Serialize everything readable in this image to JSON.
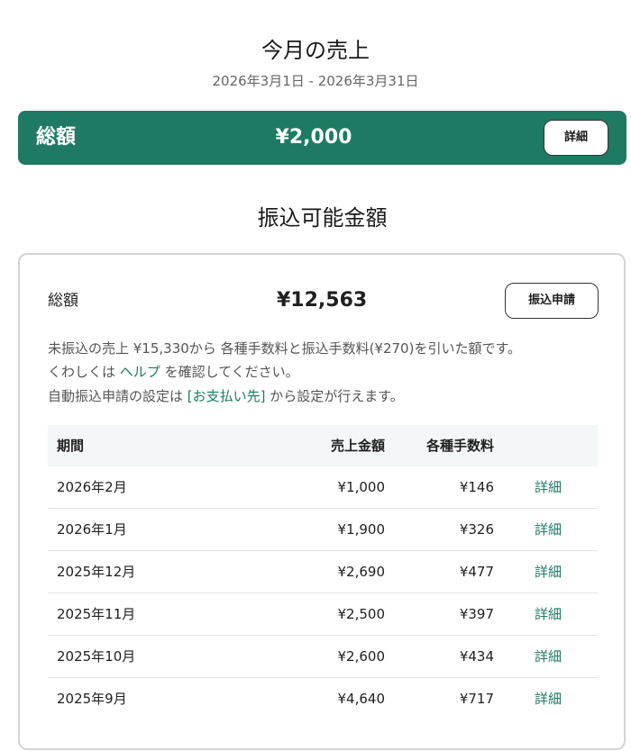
{
  "header": {
    "title": "今月の売上",
    "range": "2026年3月1日 - 2026年3月31日"
  },
  "total": {
    "label": "総額",
    "amount": "¥2,000",
    "detail_button": "詳細"
  },
  "transfer": {
    "section_title": "振込可能金額",
    "total_label": "総額",
    "amount": "¥12,563",
    "apply_button": "振込申請",
    "note_line1": "未振込の売上 ¥15,330から 各種手数料と振込手数料(¥270)を引いた額です。",
    "note_line2_before": "くわしくは ",
    "note_line2_link": "ヘルプ",
    "note_line2_after": " を確認してください。",
    "note_line3_before": "自動振込申請の設定は ",
    "note_line3_link": "[お支払い先]",
    "note_line3_after": " から設定が行えます。"
  },
  "table": {
    "headers": {
      "period": "期間",
      "sales": "売上金額",
      "fees": "各種手数料"
    },
    "rows": [
      {
        "period": "2026年2月",
        "sales": "¥1,000",
        "fees": "¥146",
        "detail": "詳細"
      },
      {
        "period": "2026年1月",
        "sales": "¥1,900",
        "fees": "¥326",
        "detail": "詳細"
      },
      {
        "period": "2025年12月",
        "sales": "¥2,690",
        "fees": "¥477",
        "detail": "詳細"
      },
      {
        "period": "2025年11月",
        "sales": "¥2,500",
        "fees": "¥397",
        "detail": "詳細"
      },
      {
        "period": "2025年10月",
        "sales": "¥2,600",
        "fees": "¥434",
        "detail": "詳細"
      },
      {
        "period": "2025年9月",
        "sales": "¥4,640",
        "fees": "¥717",
        "detail": "詳細"
      }
    ]
  },
  "colors": {
    "accent": "#1e7a63",
    "table_header_bg": "#f4f7f7",
    "border": "#d4d4d4"
  }
}
